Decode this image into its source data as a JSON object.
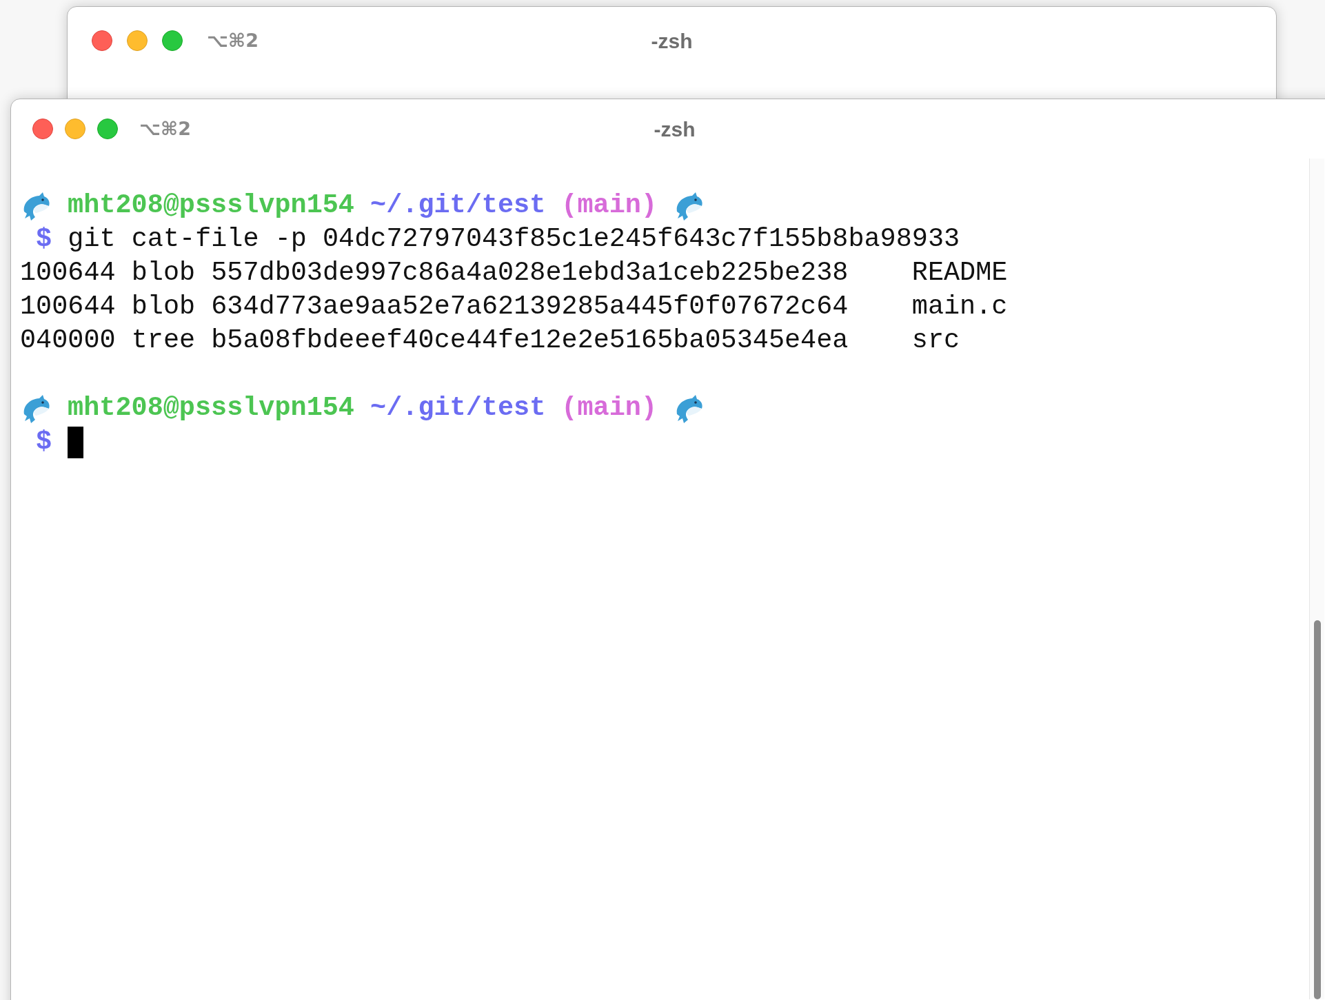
{
  "background_window": {
    "shortcut": "⌥⌘2",
    "title": "-zsh"
  },
  "window": {
    "shortcut": "⌥⌘2",
    "title": "-zsh"
  },
  "terminal": {
    "blocks": [
      {
        "prompt": {
          "user_host": "mht208@pssslvpn154",
          "path": "~/.git/test",
          "branch": "(main)",
          "symbol": "$"
        },
        "command": "git cat-file -p 04dc72797043f85c1e245f643c7f155b8ba98933",
        "output": [
          "100644 blob 557db03de997c86a4a028e1ebd3a1ceb225be238    README",
          "100644 blob 634d773ae9aa52e7a62139285a445f0f07672c64    main.c",
          "040000 tree b5a08fbdeeef40ce44fe12e2e5165ba05345e4ea    src"
        ]
      },
      {
        "prompt": {
          "user_host": "mht208@pssslvpn154",
          "path": "~/.git/test",
          "branch": "(main)",
          "symbol": "$"
        }
      }
    ]
  }
}
